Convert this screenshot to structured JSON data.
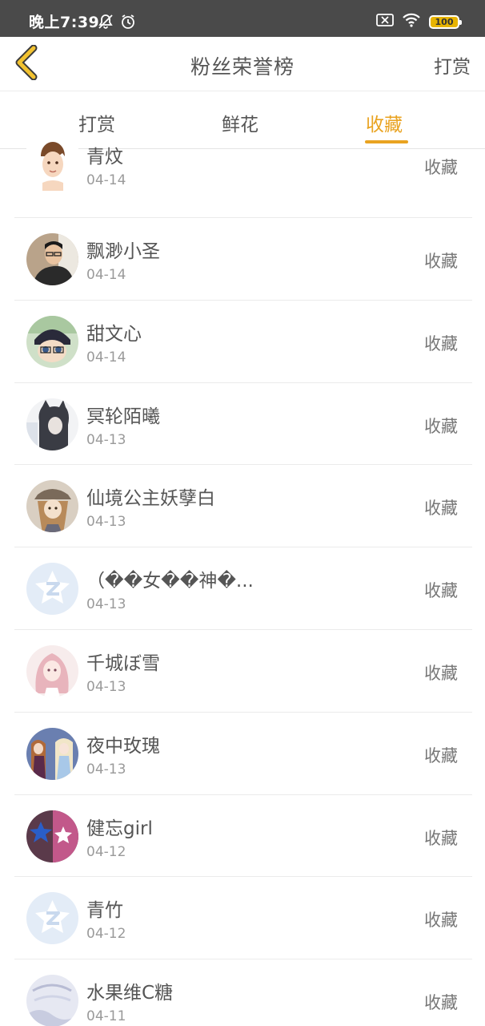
{
  "status_bar": {
    "time": "晚上7:39",
    "battery": "100"
  },
  "nav": {
    "title": "粉丝荣誉榜",
    "action_label": "打赏"
  },
  "tabs": [
    {
      "label": "打赏",
      "active": false
    },
    {
      "label": "鲜花",
      "active": false
    },
    {
      "label": "收藏",
      "active": true
    }
  ],
  "list": [
    {
      "name": "青炆",
      "date": "04-14",
      "action": "收藏",
      "avatar": "cartoon-boy"
    },
    {
      "name": "飘渺小圣",
      "date": "04-14",
      "action": "收藏",
      "avatar": "photo-man"
    },
    {
      "name": "甜文心",
      "date": "04-14",
      "action": "收藏",
      "avatar": "anime-detective"
    },
    {
      "name": "冥轮陌曦",
      "date": "04-13",
      "action": "收藏",
      "avatar": "cat-ear-girl"
    },
    {
      "name": "仙境公主妖孽白",
      "date": "04-13",
      "action": "收藏",
      "avatar": "anime-girl-hat"
    },
    {
      "name": "（��女��神�...",
      "date": "04-13",
      "action": "收藏",
      "avatar": "default-star"
    },
    {
      "name": "千城ぼ雪",
      "date": "04-13",
      "action": "收藏",
      "avatar": "pink-hair-girl"
    },
    {
      "name": "夜中玫瑰",
      "date": "04-13",
      "action": "收藏",
      "avatar": "frozen-sisters"
    },
    {
      "name": "健忘girl",
      "date": "04-12",
      "action": "收藏",
      "avatar": "star-dark"
    },
    {
      "name": "青竹",
      "date": "04-12",
      "action": "收藏",
      "avatar": "default-star"
    },
    {
      "name": "水果维C糖",
      "date": "04-11",
      "action": "收藏",
      "avatar": "light-pattern"
    }
  ]
}
